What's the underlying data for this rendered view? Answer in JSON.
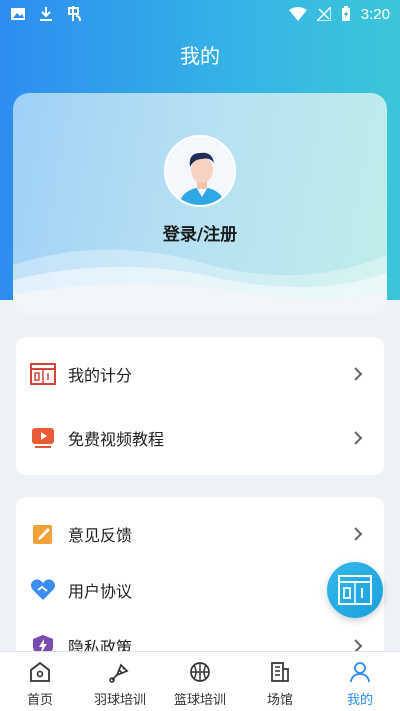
{
  "status_bar": {
    "time": "3:20"
  },
  "header": {
    "title": "我的"
  },
  "profile": {
    "login_label": "登录/注册"
  },
  "menu_group_1": [
    {
      "label": "我的计分",
      "icon": "scoreboard-icon"
    },
    {
      "label": "免费视频教程",
      "icon": "video-play-icon"
    }
  ],
  "menu_group_2": [
    {
      "label": "意见反馈",
      "icon": "edit-feedback-icon"
    },
    {
      "label": "用户协议",
      "icon": "heart-handshake-icon"
    },
    {
      "label": "隐私政策",
      "icon": "shield-lightning-icon"
    }
  ],
  "tabs": [
    {
      "label": "首页",
      "icon": "home-icon",
      "active": false
    },
    {
      "label": "羽球培训",
      "icon": "shuttlecock-icon",
      "active": false
    },
    {
      "label": "篮球培训",
      "icon": "basketball-icon",
      "active": false
    },
    {
      "label": "场馆",
      "icon": "building-icon",
      "active": false
    },
    {
      "label": "我的",
      "icon": "person-icon",
      "active": true
    }
  ],
  "colors": {
    "primary": "#2b8de8",
    "accent_red": "#d9413a",
    "accent_orange": "#f2a23a",
    "accent_purple": "#7a4bb0"
  }
}
